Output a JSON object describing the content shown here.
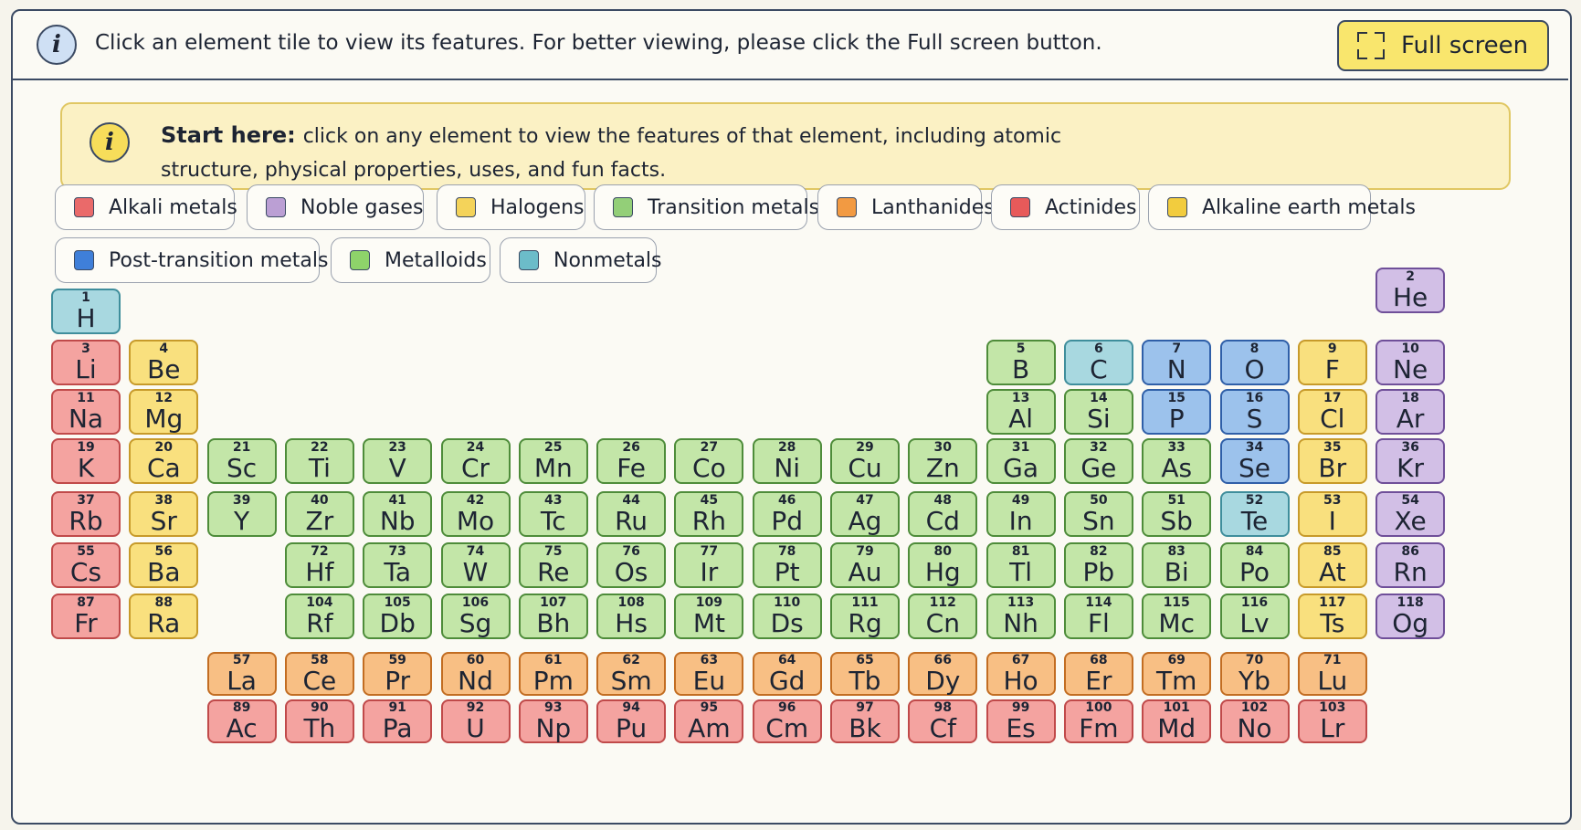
{
  "topbar": {
    "info_icon": "info-icon",
    "text": "Click an element tile to view its features. For better viewing, please click the Full screen button.",
    "fullscreen_label": "Full screen",
    "fullscreen_icon": "expand-icon"
  },
  "start_here": {
    "info_icon": "info-icon",
    "title": "Start here:",
    "body": "click on any element to view the features of that element, including atomic structure, physical properties, uses, and fun facts."
  },
  "categories": [
    {
      "key": "alkali",
      "label": "Alkali metals",
      "color": "#ea6a6a"
    },
    {
      "key": "noble",
      "label": "Noble gases",
      "color": "#bb9fd4"
    },
    {
      "key": "halogen",
      "label": "Halogens",
      "color": "#f4d35a"
    },
    {
      "key": "transition",
      "label": "Transition metals",
      "color": "#93cf78"
    },
    {
      "key": "lanthanide",
      "label": "Lanthanides",
      "color": "#f29a42"
    },
    {
      "key": "actinide",
      "label": "Actinides",
      "color": "#e75a5a"
    },
    {
      "key": "alkaline",
      "label": "Alkaline earth metals",
      "color": "#f2cc3e"
    },
    {
      "key": "post",
      "label": "Post-transition metals",
      "color": "#3f7fd9"
    },
    {
      "key": "metalloid",
      "label": "Metalloids",
      "color": "#8ed36a"
    },
    {
      "key": "nonmetal",
      "label": "Nonmetals",
      "color": "#6cbcc9"
    }
  ],
  "tile_colors": {
    "alkali": {
      "bg": "#f4a3a0",
      "border": "#c04a4a"
    },
    "alkaline": {
      "bg": "#f9e07e",
      "border": "#c79a2a"
    },
    "transition": {
      "bg": "#c3e6a8",
      "border": "#4e8c3a"
    },
    "metalloid": {
      "bg": "#c3e6a8",
      "border": "#4e8c3a"
    },
    "nonmetal": {
      "bg": "#a8d8e0",
      "border": "#3f8e9c"
    },
    "post": {
      "bg": "#9cc2ec",
      "border": "#2f5fa8"
    },
    "halogen": {
      "bg": "#f9e07e",
      "border": "#c79a2a"
    },
    "noble": {
      "bg": "#d2bfe6",
      "border": "#6f4f99"
    },
    "lanthanide": {
      "bg": "#f8bf84",
      "border": "#c26d22"
    },
    "actinide": {
      "bg": "#f4a3a0",
      "border": "#c04a4a"
    }
  },
  "elements": [
    {
      "n": 1,
      "s": "H",
      "c": "nonmetal"
    },
    {
      "n": 2,
      "s": "He",
      "c": "noble"
    },
    {
      "n": 3,
      "s": "Li",
      "c": "alkali"
    },
    {
      "n": 4,
      "s": "Be",
      "c": "alkaline"
    },
    {
      "n": 5,
      "s": "B",
      "c": "metalloid"
    },
    {
      "n": 6,
      "s": "C",
      "c": "nonmetal"
    },
    {
      "n": 7,
      "s": "N",
      "c": "post"
    },
    {
      "n": 8,
      "s": "O",
      "c": "post"
    },
    {
      "n": 9,
      "s": "F",
      "c": "halogen"
    },
    {
      "n": 10,
      "s": "Ne",
      "c": "noble"
    },
    {
      "n": 11,
      "s": "Na",
      "c": "alkali"
    },
    {
      "n": 12,
      "s": "Mg",
      "c": "alkaline"
    },
    {
      "n": 13,
      "s": "Al",
      "c": "metalloid"
    },
    {
      "n": 14,
      "s": "Si",
      "c": "metalloid"
    },
    {
      "n": 15,
      "s": "P",
      "c": "post"
    },
    {
      "n": 16,
      "s": "S",
      "c": "post"
    },
    {
      "n": 17,
      "s": "Cl",
      "c": "halogen"
    },
    {
      "n": 18,
      "s": "Ar",
      "c": "noble"
    },
    {
      "n": 19,
      "s": "K",
      "c": "alkali"
    },
    {
      "n": 20,
      "s": "Ca",
      "c": "alkaline"
    },
    {
      "n": 21,
      "s": "Sc",
      "c": "transition"
    },
    {
      "n": 22,
      "s": "Ti",
      "c": "transition"
    },
    {
      "n": 23,
      "s": "V",
      "c": "transition"
    },
    {
      "n": 24,
      "s": "Cr",
      "c": "transition"
    },
    {
      "n": 25,
      "s": "Mn",
      "c": "transition"
    },
    {
      "n": 26,
      "s": "Fe",
      "c": "transition"
    },
    {
      "n": 27,
      "s": "Co",
      "c": "transition"
    },
    {
      "n": 28,
      "s": "Ni",
      "c": "transition"
    },
    {
      "n": 29,
      "s": "Cu",
      "c": "transition"
    },
    {
      "n": 30,
      "s": "Zn",
      "c": "transition"
    },
    {
      "n": 31,
      "s": "Ga",
      "c": "metalloid"
    },
    {
      "n": 32,
      "s": "Ge",
      "c": "metalloid"
    },
    {
      "n": 33,
      "s": "As",
      "c": "metalloid"
    },
    {
      "n": 34,
      "s": "Se",
      "c": "post"
    },
    {
      "n": 35,
      "s": "Br",
      "c": "halogen"
    },
    {
      "n": 36,
      "s": "Kr",
      "c": "noble"
    },
    {
      "n": 37,
      "s": "Rb",
      "c": "alkali"
    },
    {
      "n": 38,
      "s": "Sr",
      "c": "alkaline"
    },
    {
      "n": 39,
      "s": "Y",
      "c": "transition"
    },
    {
      "n": 40,
      "s": "Zr",
      "c": "transition"
    },
    {
      "n": 41,
      "s": "Nb",
      "c": "transition"
    },
    {
      "n": 42,
      "s": "Mo",
      "c": "transition"
    },
    {
      "n": 43,
      "s": "Tc",
      "c": "transition"
    },
    {
      "n": 44,
      "s": "Ru",
      "c": "transition"
    },
    {
      "n": 45,
      "s": "Rh",
      "c": "transition"
    },
    {
      "n": 46,
      "s": "Pd",
      "c": "transition"
    },
    {
      "n": 47,
      "s": "Ag",
      "c": "transition"
    },
    {
      "n": 48,
      "s": "Cd",
      "c": "transition"
    },
    {
      "n": 49,
      "s": "In",
      "c": "metalloid"
    },
    {
      "n": 50,
      "s": "Sn",
      "c": "metalloid"
    },
    {
      "n": 51,
      "s": "Sb",
      "c": "metalloid"
    },
    {
      "n": 52,
      "s": "Te",
      "c": "nonmetal"
    },
    {
      "n": 53,
      "s": "I",
      "c": "halogen"
    },
    {
      "n": 54,
      "s": "Xe",
      "c": "noble"
    },
    {
      "n": 55,
      "s": "Cs",
      "c": "alkali"
    },
    {
      "n": 56,
      "s": "Ba",
      "c": "alkaline"
    },
    {
      "n": 72,
      "s": "Hf",
      "c": "transition"
    },
    {
      "n": 73,
      "s": "Ta",
      "c": "transition"
    },
    {
      "n": 74,
      "s": "W",
      "c": "transition"
    },
    {
      "n": 75,
      "s": "Re",
      "c": "transition"
    },
    {
      "n": 76,
      "s": "Os",
      "c": "transition"
    },
    {
      "n": 77,
      "s": "Ir",
      "c": "transition"
    },
    {
      "n": 78,
      "s": "Pt",
      "c": "transition"
    },
    {
      "n": 79,
      "s": "Au",
      "c": "transition"
    },
    {
      "n": 80,
      "s": "Hg",
      "c": "transition"
    },
    {
      "n": 81,
      "s": "Tl",
      "c": "metalloid"
    },
    {
      "n": 82,
      "s": "Pb",
      "c": "metalloid"
    },
    {
      "n": 83,
      "s": "Bi",
      "c": "metalloid"
    },
    {
      "n": 84,
      "s": "Po",
      "c": "metalloid"
    },
    {
      "n": 85,
      "s": "At",
      "c": "halogen"
    },
    {
      "n": 86,
      "s": "Rn",
      "c": "noble"
    },
    {
      "n": 87,
      "s": "Fr",
      "c": "alkali"
    },
    {
      "n": 88,
      "s": "Ra",
      "c": "alkaline"
    },
    {
      "n": 104,
      "s": "Rf",
      "c": "transition"
    },
    {
      "n": 105,
      "s": "Db",
      "c": "transition"
    },
    {
      "n": 106,
      "s": "Sg",
      "c": "transition"
    },
    {
      "n": 107,
      "s": "Bh",
      "c": "transition"
    },
    {
      "n": 108,
      "s": "Hs",
      "c": "transition"
    },
    {
      "n": 109,
      "s": "Mt",
      "c": "transition"
    },
    {
      "n": 110,
      "s": "Ds",
      "c": "transition"
    },
    {
      "n": 111,
      "s": "Rg",
      "c": "transition"
    },
    {
      "n": 112,
      "s": "Cn",
      "c": "transition"
    },
    {
      "n": 113,
      "s": "Nh",
      "c": "metalloid"
    },
    {
      "n": 114,
      "s": "Fl",
      "c": "metalloid"
    },
    {
      "n": 115,
      "s": "Mc",
      "c": "metalloid"
    },
    {
      "n": 116,
      "s": "Lv",
      "c": "metalloid"
    },
    {
      "n": 117,
      "s": "Ts",
      "c": "halogen"
    },
    {
      "n": 118,
      "s": "Og",
      "c": "noble"
    },
    {
      "n": 57,
      "s": "La",
      "c": "lanthanide"
    },
    {
      "n": 58,
      "s": "Ce",
      "c": "lanthanide"
    },
    {
      "n": 59,
      "s": "Pr",
      "c": "lanthanide"
    },
    {
      "n": 60,
      "s": "Nd",
      "c": "lanthanide"
    },
    {
      "n": 61,
      "s": "Pm",
      "c": "lanthanide"
    },
    {
      "n": 62,
      "s": "Sm",
      "c": "lanthanide"
    },
    {
      "n": 63,
      "s": "Eu",
      "c": "lanthanide"
    },
    {
      "n": 64,
      "s": "Gd",
      "c": "lanthanide"
    },
    {
      "n": 65,
      "s": "Tb",
      "c": "lanthanide"
    },
    {
      "n": 66,
      "s": "Dy",
      "c": "lanthanide"
    },
    {
      "n": 67,
      "s": "Ho",
      "c": "lanthanide"
    },
    {
      "n": 68,
      "s": "Er",
      "c": "lanthanide"
    },
    {
      "n": 69,
      "s": "Tm",
      "c": "lanthanide"
    },
    {
      "n": 70,
      "s": "Yb",
      "c": "lanthanide"
    },
    {
      "n": 71,
      "s": "Lu",
      "c": "lanthanide"
    },
    {
      "n": 89,
      "s": "Ac",
      "c": "actinide"
    },
    {
      "n": 90,
      "s": "Th",
      "c": "actinide"
    },
    {
      "n": 91,
      "s": "Pa",
      "c": "actinide"
    },
    {
      "n": 92,
      "s": "U",
      "c": "actinide"
    },
    {
      "n": 93,
      "s": "Np",
      "c": "actinide"
    },
    {
      "n": 94,
      "s": "Pu",
      "c": "actinide"
    },
    {
      "n": 95,
      "s": "Am",
      "c": "actinide"
    },
    {
      "n": 96,
      "s": "Cm",
      "c": "actinide"
    },
    {
      "n": 97,
      "s": "Bk",
      "c": "actinide"
    },
    {
      "n": 98,
      "s": "Cf",
      "c": "actinide"
    },
    {
      "n": 99,
      "s": "Es",
      "c": "actinide"
    },
    {
      "n": 100,
      "s": "Fm",
      "c": "actinide"
    },
    {
      "n": 101,
      "s": "Md",
      "c": "actinide"
    },
    {
      "n": 102,
      "s": "No",
      "c": "actinide"
    },
    {
      "n": 103,
      "s": "Lr",
      "c": "actinide"
    }
  ]
}
